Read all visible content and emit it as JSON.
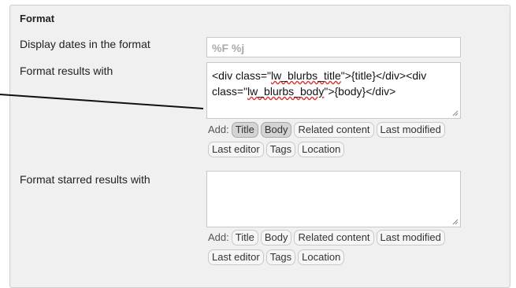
{
  "section": {
    "title": "Format"
  },
  "date_format": {
    "label": "Display dates in the format",
    "placeholder": "%F %j"
  },
  "results_format": {
    "label": "Format results with",
    "line1_prefix": "<div class=\"",
    "line1_class": "lw_blurbs_title",
    "line1_suffix": "\">{title}</div><div",
    "line2_prefix": "class=\"",
    "line2_class": "lw_blurbs_body",
    "line2_suffix": "\">{body}</div>",
    "add_label": "Add:",
    "buttons": [
      "Title",
      "Body",
      "Related content",
      "Last modified",
      "Last editor",
      "Tags",
      "Location"
    ]
  },
  "starred_format": {
    "label": "Format starred results with",
    "add_label": "Add:",
    "buttons": [
      "Title",
      "Body",
      "Related content",
      "Last modified",
      "Last editor",
      "Tags",
      "Location"
    ]
  }
}
